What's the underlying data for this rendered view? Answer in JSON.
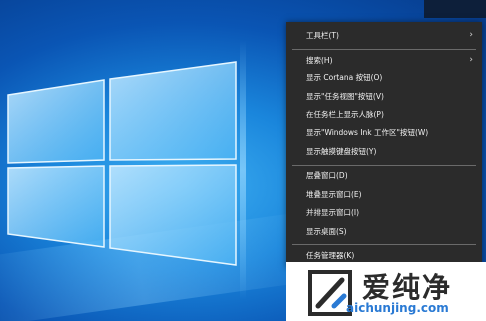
{
  "menu": {
    "items": [
      {
        "label": "工具栏(T)",
        "submenu": true
      },
      {
        "label": "搜索(H)",
        "submenu": true
      },
      {
        "label": "显示 Cortana 按钮(O)",
        "submenu": false
      },
      {
        "label": "显示\"任务视图\"按钮(V)",
        "submenu": false
      },
      {
        "label": "在任务栏上显示人脉(P)",
        "submenu": false
      },
      {
        "label": "显示\"Windows Ink 工作区\"按钮(W)",
        "submenu": false
      },
      {
        "label": "显示触摸键盘按钮(Y)",
        "submenu": false
      },
      {
        "label": "层叠窗口(D)",
        "submenu": false
      },
      {
        "label": "堆叠显示窗口(E)",
        "submenu": false
      },
      {
        "label": "并排显示窗口(I)",
        "submenu": false
      },
      {
        "label": "显示桌面(S)",
        "submenu": false
      },
      {
        "label": "任务管理器(K)",
        "submenu": false
      }
    ],
    "submenu_arrow": "›"
  },
  "watermark": {
    "title": "爱纯净",
    "url": "aichunjing.com"
  },
  "colors": {
    "menu_bg": "#2b2b2b",
    "menu_text": "#f2f2f2",
    "separator": "#6a6a6a",
    "watermark_url": "#2a7ad4"
  },
  "icons": [
    "windows-logo",
    "chevron-right-icon",
    "watermark-logo-icon"
  ]
}
